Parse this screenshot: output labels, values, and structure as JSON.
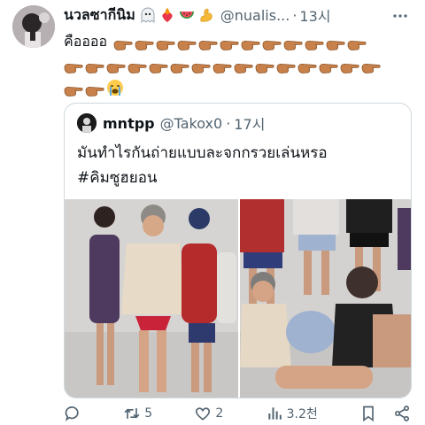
{
  "tweet": {
    "display_name": "นวลซากีนิม",
    "handle": "@nualis...",
    "time_separator": "·",
    "time": "13시",
    "text_line": "คืออออ",
    "more_icon": "more-icon"
  },
  "quote": {
    "name": "mntpp",
    "handle": "@Takox0",
    "time_separator": "·",
    "time": "17시",
    "text": "มันทำไรกันถ่ายแบบละจกกรวยเล่นหรอ",
    "hashtag": "#คิมซูฮยอน"
  },
  "actions": {
    "reply_icon": "reply-icon",
    "retweet_icon": "retweet-icon",
    "retweet_count": "5",
    "like_icon": "heart-icon",
    "like_count": "2",
    "views_icon": "views-icon",
    "views_count": "3.2천",
    "bookmark_icon": "bookmark-icon",
    "share_icon": "share-icon"
  },
  "colors": {
    "text": "#0f1419",
    "muted": "#536471",
    "border": "#cfd9de"
  }
}
